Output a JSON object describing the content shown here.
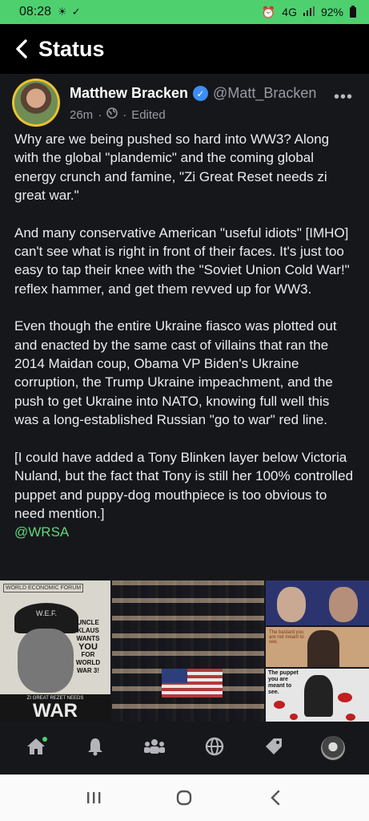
{
  "status_bar": {
    "time": "08:28",
    "battery": "92%",
    "network": "4G"
  },
  "app_bar": {
    "title": "Status"
  },
  "post": {
    "author_name": "Matthew Bracken",
    "handle": "@Matt_Bracken",
    "time_ago": "26m",
    "separator": "·",
    "edited": "Edited",
    "paragraphs": [
      "Why are we being pushed so hard into WW3? Along with the global \"plandemic\" and the coming global energy crunch and famine, \"Zi Great Reset needs zi great war.\"",
      "And many conservative American \"useful idiots\" [IMHO] can't see what is right in front of their faces. It's just too easy to tap their knee with the \"Soviet Union Cold War!\" reflex hammer, and get them revved up for WW3.",
      "Even though the entire Ukraine fiasco was plotted out and enacted by the same cast of villains that ran the 2014 Maidan coup, Obama VP Biden's Ukraine corruption, the Trump Ukraine impeachment, and the push to get Ukraine into NATO, knowing full well this was a long-established Russian \"go to war\" red line.",
      "[I could have added a Tony Blinken layer below Victoria Nuland, but the fact that Tony is still her 100% controlled puppet and puppy-dog mouthpiece is too obvious to need mention.]"
    ],
    "mention": "@WRSA"
  },
  "media": {
    "image1": {
      "badge": "WORLD ECONOMIC FORUM",
      "hat_text": "W.E.F.",
      "copy_lines": [
        "UNCLE",
        "KLAUS",
        "WANTS",
        "YOU",
        "FOR",
        "WORLD",
        "WAR 3!"
      ],
      "bottom_small": "ZI GREAT REZET NEEDS",
      "bottom_big": "WAR"
    },
    "image3b_text": "The bastard you are not meant to see.",
    "image3c_text": "The puppet you are meant to see."
  },
  "bottom_nav": [
    {
      "name": "home",
      "icon": "home-icon"
    },
    {
      "name": "notifications",
      "icon": "bell-icon"
    },
    {
      "name": "groups",
      "icon": "people-icon"
    },
    {
      "name": "explore",
      "icon": "globe-icon"
    },
    {
      "name": "tags",
      "icon": "tag-icon"
    },
    {
      "name": "profile",
      "icon": "avatar-icon"
    }
  ],
  "colors": {
    "accent": "#4ed06f",
    "background": "#16171b",
    "verified": "#3c8ef7",
    "avatar_ring": "#e8c230"
  }
}
